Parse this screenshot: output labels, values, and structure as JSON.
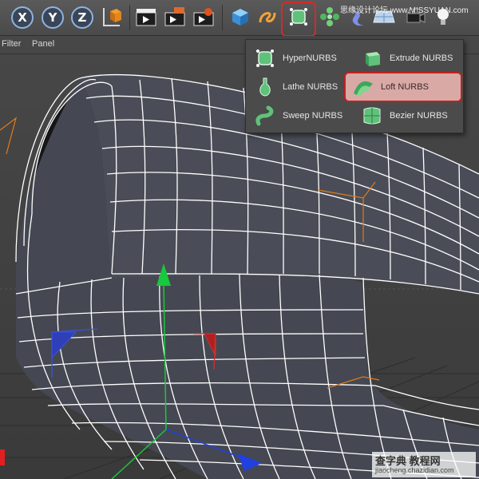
{
  "toolbar": {
    "axis_x": "X",
    "axis_y": "Y",
    "axis_z": "Z",
    "icons": [
      "lock-axis-x-icon",
      "lock-axis-y-icon",
      "lock-axis-z-icon",
      "coordinate-system-icon",
      "render-view-icon",
      "render-picture-viewer-icon",
      "render-settings-icon",
      "cube-icon",
      "spline-icon",
      "nurbs-icon",
      "array-icon",
      "deformer-icon",
      "floor-icon",
      "camera-icon",
      "light-icon"
    ]
  },
  "menubar": {
    "items": [
      "Filter",
      "Panel"
    ]
  },
  "popup": {
    "items": [
      {
        "label": "HyperNURBS",
        "icon": "hypernurbs-icon"
      },
      {
        "label": "Extrude NURBS",
        "icon": "extrude-nurbs-icon"
      },
      {
        "label": "Lathe NURBS",
        "icon": "lathe-nurbs-icon"
      },
      {
        "label": "Loft NURBS",
        "icon": "loft-nurbs-icon",
        "highlighted": true
      },
      {
        "label": "Sweep NURBS",
        "icon": "sweep-nurbs-icon"
      },
      {
        "label": "Bezier NURBS",
        "icon": "bezier-nurbs-icon"
      }
    ]
  },
  "watermark": {
    "top": "思缘设计论坛 www.MISSYUAN.com",
    "bottom_title": "查字典 教程网",
    "bottom_url": "jiaocheng.chazidian.com"
  },
  "colors": {
    "highlight": "#d22b2b",
    "axis_y": "#19c83c",
    "axis_x": "#e02020",
    "axis_z": "#2140e0",
    "wireframe": "#ffffff",
    "surface": "#4a4d57"
  }
}
